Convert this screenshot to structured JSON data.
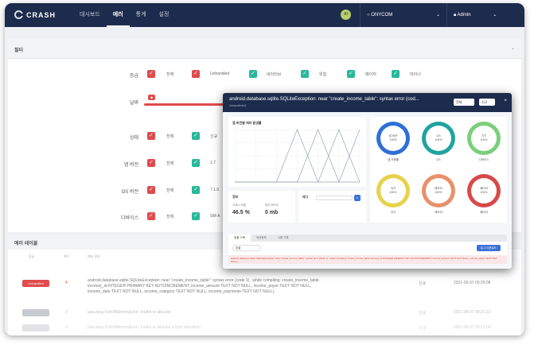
{
  "app": {
    "logo": "CRASH"
  },
  "nav": {
    "items": [
      "대시보드",
      "에러",
      "통계",
      "설정"
    ],
    "active": "에러"
  },
  "project": {
    "avatar": "AI",
    "name": "ONYCOM"
  },
  "user": {
    "name": "Admin"
  },
  "filter": {
    "title": "필터",
    "level_label": "등급",
    "level_options": [
      "전체",
      "Unhandled",
      "네이티브",
      "위험",
      "메이저",
      "마이너"
    ],
    "period_label": "날짜",
    "status_label": "상태",
    "status_options": [
      "전체",
      "신규"
    ],
    "app_version_label": "앱 버전",
    "app_version_options": [
      "전체",
      "1.7"
    ],
    "os_version_label": "OS 버전",
    "os_version_options": [
      "전체",
      "7.1.0"
    ],
    "device_label": "디바이스",
    "device_options": [
      "전체",
      "SM-A"
    ]
  },
  "errors_table": {
    "title": "에러 테이블",
    "headers": [
      "등급",
      "횟수",
      "에러 정보",
      "상태",
      "최근 발생일"
    ],
    "rows": [
      {
        "level": "Unhandled",
        "level_color": "#e04b4b",
        "count": "4",
        "message": "android.database.sqlite.SQLiteException: near \"create_income_table\": syntax error (code 1) , while compiling: create_income_table income(_id INTEGER PRIMARY KEY AUTOINCREMENT, income_amount TEXT NOT NULL, income_payer TEXT NOT NULL, income_date TEXT NOT NULL, income_category TEXT NOT NULL, income_payments TEXT NOT NULL)",
        "status": "신규",
        "date": "2021-06-07 09:26:08"
      },
      {
        "level": "",
        "level_color": "#9aa0a8",
        "count": "3",
        "message": "java.lang.OutOfMemoryError: Failed to allocate",
        "status": "신규",
        "date": "2021-06-07 09:21:12"
      },
      {
        "level": "",
        "level_color": "#b5bac1",
        "count": "3",
        "message": "java.lang.OutOfMemoryError: Failed to allocate a byte allocation",
        "status": "신규",
        "date": "2021-06-07 09:21:04"
      }
    ]
  },
  "modal": {
    "title": "android.database.sqlite.SQLiteException: near \"create_income_table\": syntax error (cod...",
    "subtitle": "Unhandled/UI",
    "select_value": "전체",
    "status_label": "신규",
    "close_icon": "×",
    "chart_title": "앱 버전별 에러 발생률",
    "info_title": "정보",
    "crash_rate_label": "크래시 비율",
    "crash_rate_value": "46.5 %",
    "memory_label": "평균 메모리",
    "memory_value": "0 mb",
    "search_title": "태그",
    "tabs": [
      "호출 스택",
      "세션정보",
      "사용 기록"
    ],
    "active_tab": "호출 스택",
    "stack_select": "호출",
    "stack_button": "로그 다운로드",
    "error_line": "android.database.sqlite.SQLiteException: near \"create_income_table\": syntax error (code 1) , while compiling: create_income_table income(_id INTEGER PRIMARY KEY AUTOINCREMENT, income_amount TEXT NOT NULL, income_payer TEXT NOT NULL)",
    "gauges": [
      {
        "label": "앱 버전",
        "value": "100%",
        "caption": "앱 사용률",
        "color": "#2f6fd6"
      },
      {
        "label": "OS",
        "value": "100%",
        "caption": "OS",
        "color": "#1fa3a0"
      },
      {
        "label": "기기",
        "value": "100%",
        "caption": "디바이스",
        "color": "#7ccf7a"
      },
      {
        "label": "국가",
        "value": "100%",
        "caption": "국가",
        "color": "#e6d24a"
      },
      {
        "label": "메모리",
        "value": "100%",
        "caption": "메모리",
        "color": "#e8906a"
      },
      {
        "label": "배터리",
        "value": "100%",
        "caption": "배터리",
        "color": "#d84848"
      }
    ]
  },
  "chart_data": {
    "type": "line",
    "title": "앱 버전별 에러 발생률",
    "x": [
      0,
      1,
      2,
      3,
      4,
      5,
      6
    ],
    "series": [
      {
        "values": [
          0,
          0,
          0,
          1,
          0,
          0,
          0
        ]
      },
      {
        "values": [
          0,
          0,
          0,
          0,
          0,
          1,
          0
        ]
      },
      {
        "values": [
          0,
          0,
          0,
          0,
          1,
          0,
          1
        ]
      }
    ],
    "ylim": [
      0,
      1
    ]
  }
}
